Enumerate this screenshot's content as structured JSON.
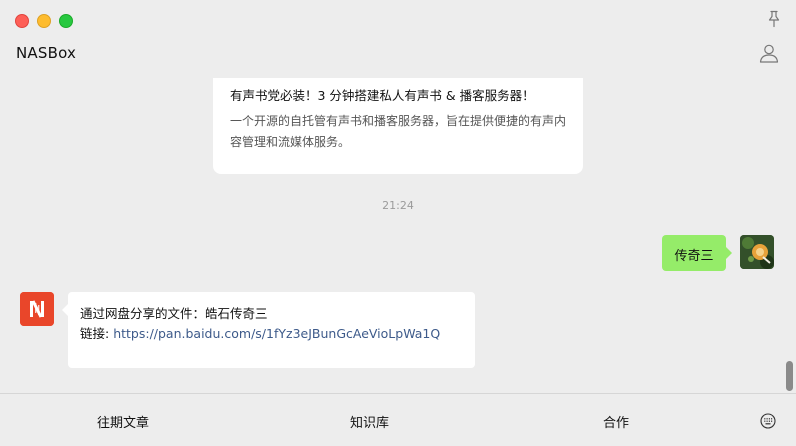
{
  "app": {
    "title": "NASBox"
  },
  "article_card": {
    "title": "有声书党必装！3 分钟搭建私人有声书 & 播客服务器！",
    "description": "一个开源的自托管有声书和播客服务器，旨在提供便捷的有声内容管理和流媒体服务。"
  },
  "timestamp": "21:24",
  "outgoing_message": {
    "text": "传奇三"
  },
  "incoming_message": {
    "line1": "通过网盘分享的文件：皓石传奇三",
    "link_label": "链接: ",
    "link_url": "https://pan.baidu.com/s/1fYz3eJBunGcAeVioLpWa1Q"
  },
  "bottom_menu": {
    "item1": "往期文章",
    "item2": "知识库",
    "item3": "合作"
  },
  "icons": {
    "pin": "pin-icon",
    "profile": "profile-icon",
    "keyboard": "keyboard-icon"
  },
  "colors": {
    "sent_bubble": "#95ec69",
    "link": "#3d5a8a",
    "avatar_brand": "#e9462a"
  }
}
